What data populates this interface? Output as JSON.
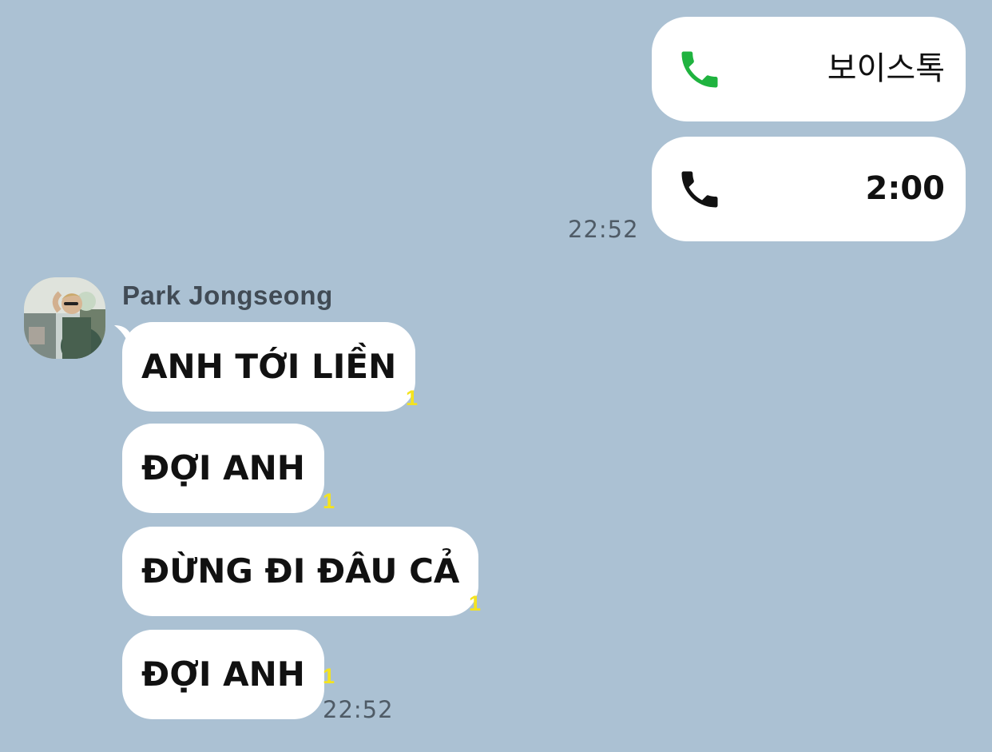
{
  "outgoing": {
    "voice_call": {
      "icon": "phone-icon-green",
      "label": "보이스톡",
      "color": "#1fb33f"
    },
    "call_duration": {
      "icon": "phone-icon-black",
      "label": "2:00",
      "color": "#111111"
    },
    "time": "22:52"
  },
  "incoming": {
    "sender_name": "Park Jongseong",
    "avatar_icon": "profile-photo",
    "messages": [
      {
        "text": "ANH TỚI LIỀN",
        "unread": "1"
      },
      {
        "text": "ĐỢI ANH",
        "unread": "1"
      },
      {
        "text": "ĐỪNG ĐI ĐÂU CẢ",
        "unread": "1"
      },
      {
        "text": "ĐỢI ANH",
        "unread": "1"
      }
    ],
    "time": "22:52"
  },
  "colors": {
    "background": "#abc1d3",
    "bubble": "#ffffff",
    "unread_badge": "#f4e31f",
    "timestamp": "#4f5b66"
  }
}
